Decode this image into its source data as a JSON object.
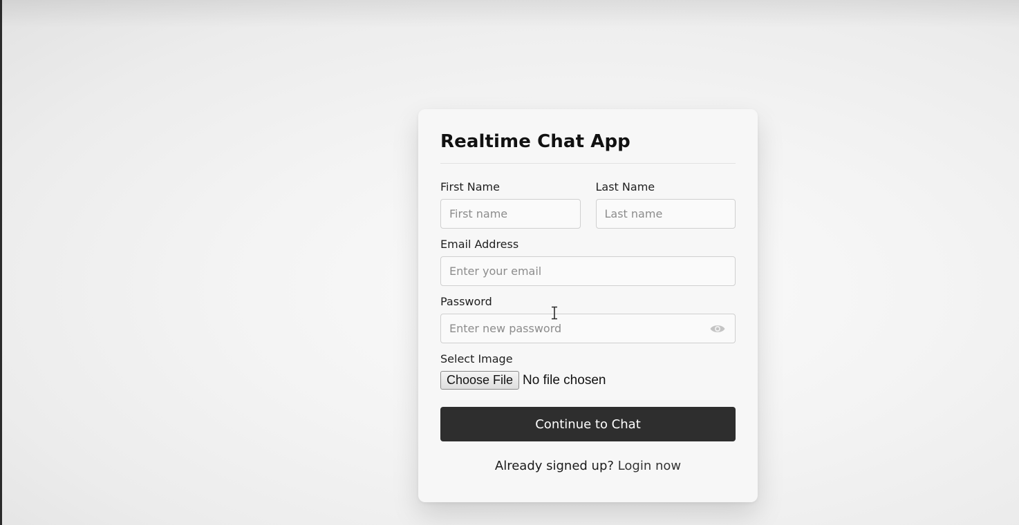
{
  "card": {
    "title": "Realtime Chat App"
  },
  "form": {
    "first_name": {
      "label": "First Name",
      "placeholder": "First name",
      "value": ""
    },
    "last_name": {
      "label": "Last Name",
      "placeholder": "Last name",
      "value": ""
    },
    "email": {
      "label": "Email Address",
      "placeholder": "Enter your email",
      "value": ""
    },
    "password": {
      "label": "Password",
      "placeholder": "Enter new password",
      "value": "",
      "toggle_icon": "eye-icon"
    },
    "image": {
      "label": "Select Image",
      "button_label": "Choose File",
      "status": "No file chosen"
    },
    "submit_label": "Continue to Chat"
  },
  "footer": {
    "text": "Already signed up? ",
    "link_label": "Login now"
  },
  "colors": {
    "button_bg": "#2e2e2e",
    "card_bg": "#f7f7f7",
    "input_border": "#cfcfcf"
  }
}
